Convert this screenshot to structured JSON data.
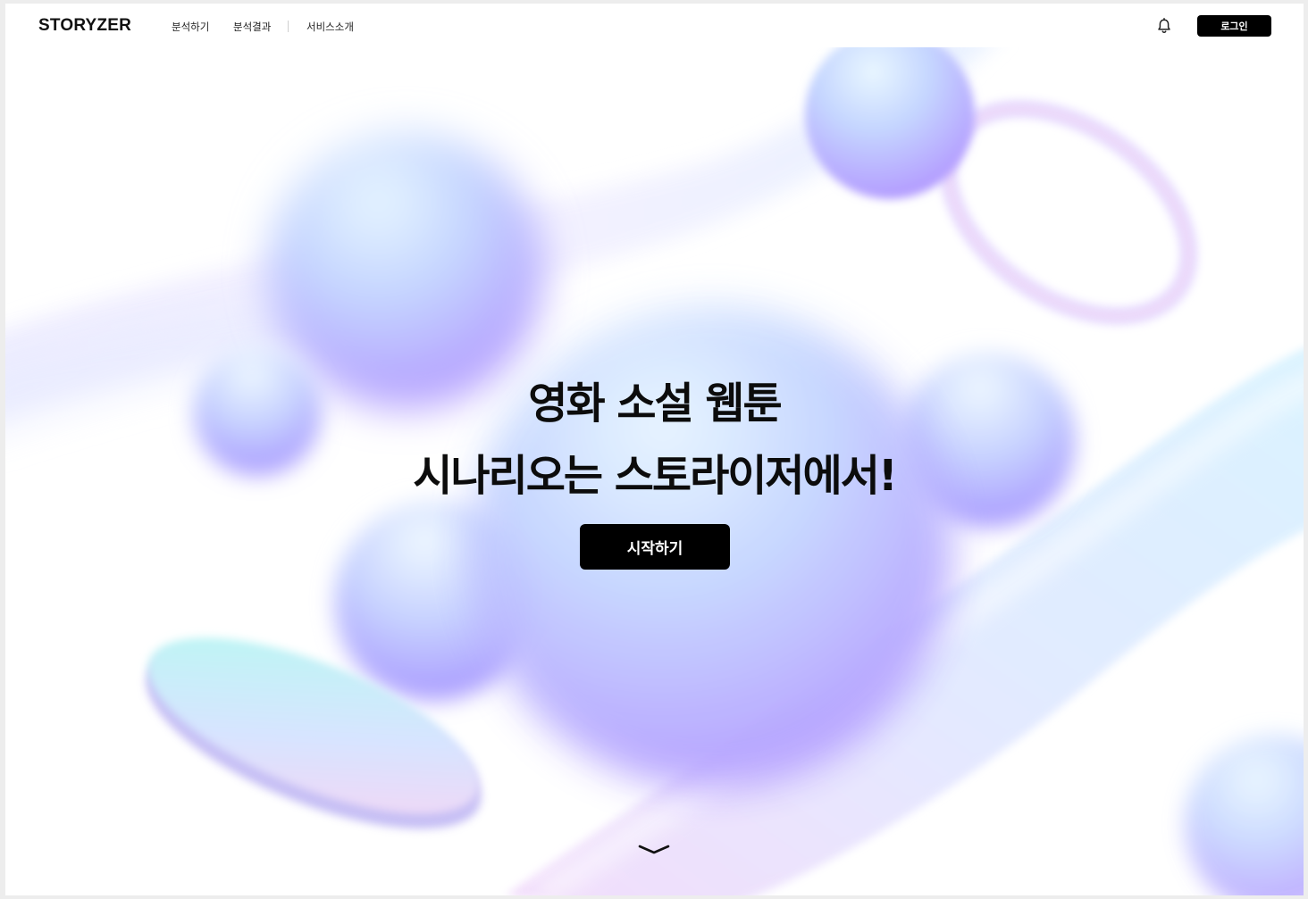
{
  "header": {
    "logo": "STORYZER",
    "nav": [
      {
        "label": "분석하기"
      },
      {
        "label": "분석결과"
      },
      {
        "label": "서비스소개"
      }
    ],
    "notification_icon": "bell-icon",
    "login_label": "로그인"
  },
  "hero": {
    "headline_line1": "영화 소설 웹툰",
    "headline_line2": "시나리오는 스토라이저에서!",
    "cta_label": "시작하기",
    "scroll_icon": "chevron-down-icon"
  },
  "colors": {
    "primary_button": "#000000",
    "button_text": "#ffffff",
    "accent_lavender": "#b9b0ff",
    "accent_blue": "#a9c6ff",
    "accent_mint": "#b8f7ee",
    "accent_pink": "#f5ccf0"
  }
}
